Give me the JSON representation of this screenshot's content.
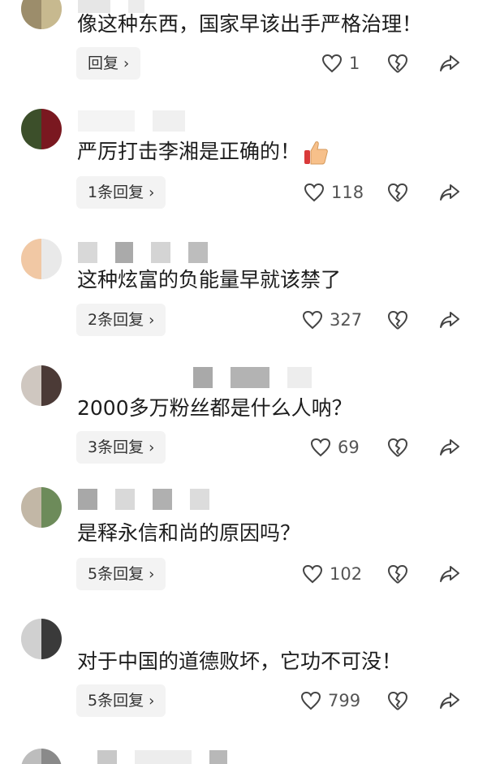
{
  "comments": [
    {
      "text": "像这种东西，国家早该出手严格治理！",
      "reply_label": "回复",
      "likes": "1"
    },
    {
      "text": "严厉打击李湘是正确的！",
      "reply_label": "1条回复",
      "likes": "118"
    },
    {
      "text": "这种炫富的负能量早就该禁了",
      "reply_label": "2条回复",
      "likes": "327"
    },
    {
      "text": "2000多万粉丝都是什么人呐？",
      "reply_label": "3条回复",
      "likes": "69"
    },
    {
      "text": "是释永信和尚的原因吗？",
      "reply_label": "5条回复",
      "likes": "102"
    },
    {
      "text": "对于中国的道德败坏，它功不可没！",
      "reply_label": "5条回复",
      "likes": "799"
    }
  ],
  "icons": {
    "like": "heart-outline",
    "dislike": "broken-heart",
    "share": "share-arrow",
    "reply_chevron": "chevron-right",
    "emoji": "thumbs-up"
  },
  "colors": {
    "text": "#1d1d1d",
    "meta": "#555555",
    "reply_bg": "#f3f3f3",
    "blur": "#d6d6d6"
  }
}
